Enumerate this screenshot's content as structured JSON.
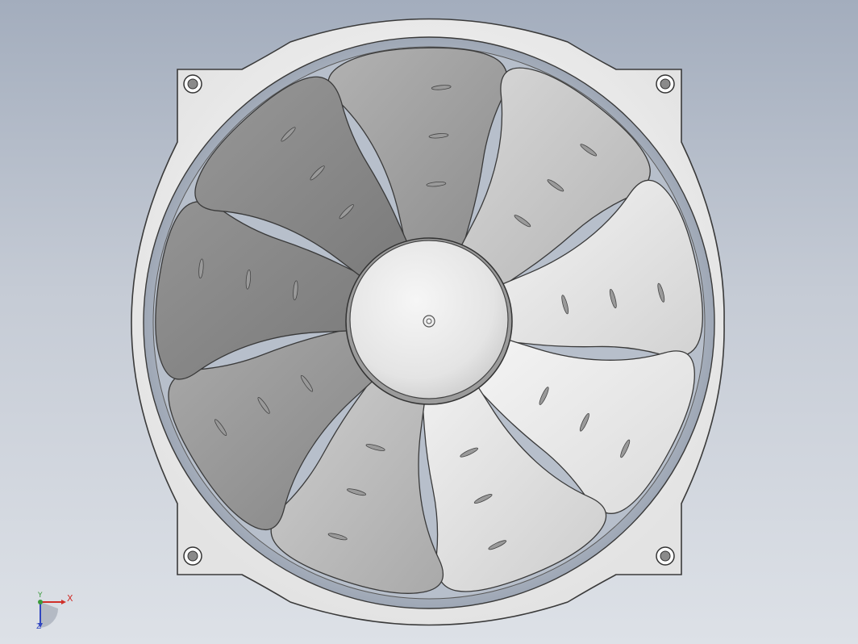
{
  "viewport": {
    "background_top": "#a3adbd",
    "background_bottom": "#dde1e7"
  },
  "model": {
    "part": "fan",
    "blade_count": 9,
    "corner_mount_holes": 4,
    "frame_color": "#f1f1f1",
    "blade_light_color": "#f4f4f4",
    "blade_dark_color": "#7a7a7a",
    "hub_color": "#e6e6e6"
  },
  "triad": {
    "x_label": "X",
    "y_label": "Y",
    "z_label": "Z",
    "x_color": "#d0302a",
    "y_color": "#3b9a3b",
    "z_color": "#3046c0"
  }
}
